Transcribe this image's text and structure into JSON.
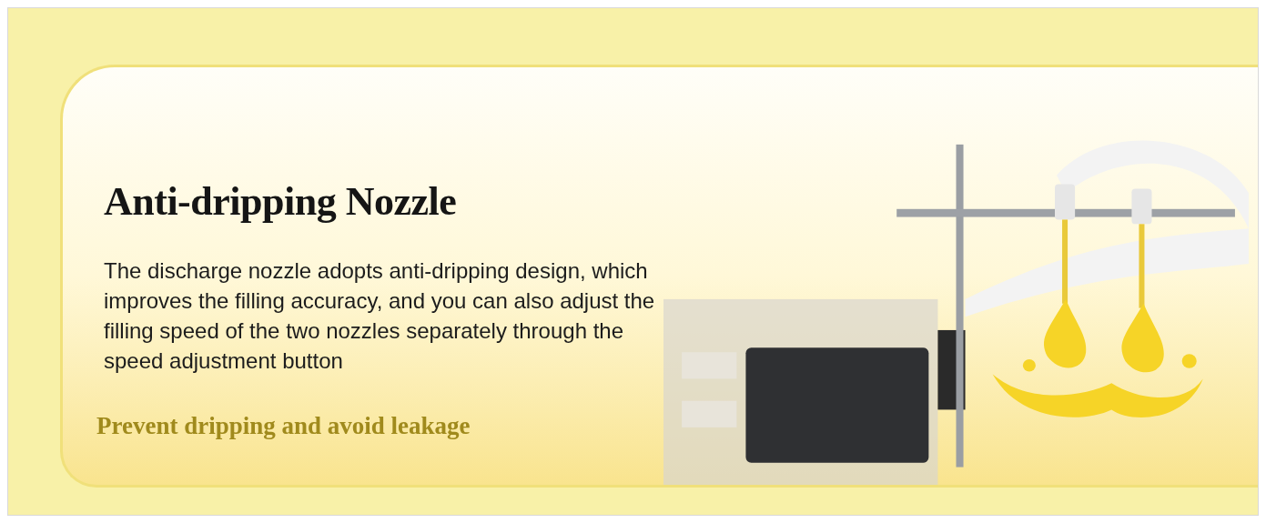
{
  "banner": {
    "title": "Anti-dripping Nozzle",
    "description": "The discharge nozzle adopts anti-dripping design, which improves the filling accuracy, and you can also adjust the filling speed of the two nozzles separately through the speed adjustment button",
    "tagline": "Prevent dripping and avoid leakage"
  }
}
